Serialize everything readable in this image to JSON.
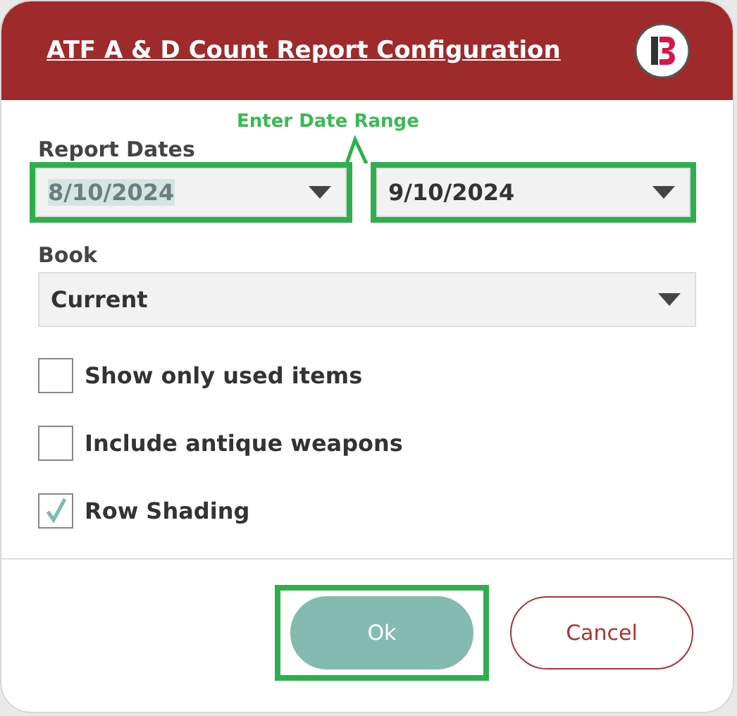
{
  "dialog": {
    "title": "ATF A & D Count Report Configuration"
  },
  "annotation": {
    "text": "Enter Date Range"
  },
  "report_dates": {
    "label": "Report Dates",
    "fields": [
      {
        "value": "8/10/2024",
        "text_selected": true,
        "highlighted": true
      },
      {
        "value": "9/10/2024",
        "text_selected": false,
        "highlighted": true
      }
    ]
  },
  "book": {
    "label": "Book",
    "value": "Current"
  },
  "options": [
    {
      "label": "Show only used items",
      "checked": false
    },
    {
      "label": "Include antique weapons",
      "checked": false
    },
    {
      "label": "Row Shading",
      "checked": true
    }
  ],
  "buttons": [
    {
      "label": "Ok",
      "kind": "primary",
      "highlighted": true
    },
    {
      "label": "Cancel",
      "kind": "secondary",
      "highlighted": false
    }
  ]
}
